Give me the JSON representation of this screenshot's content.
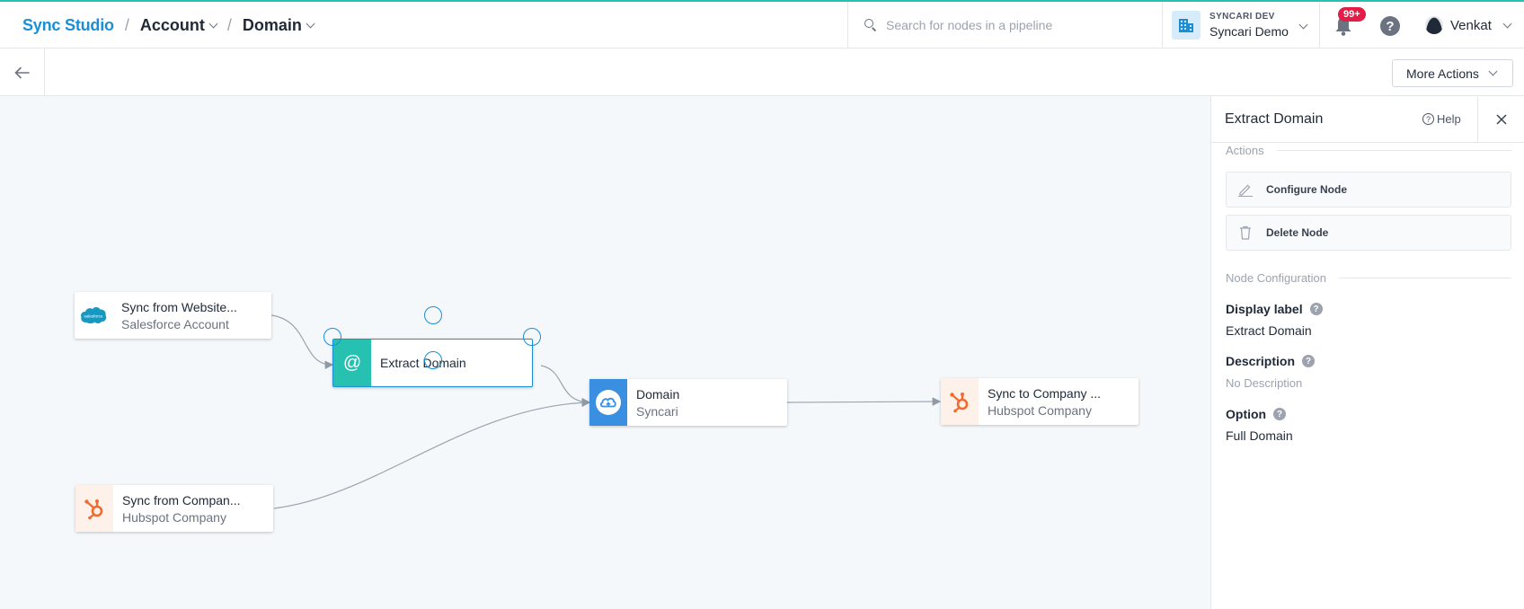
{
  "header": {
    "breadcrumbs": [
      "Sync Studio",
      "Account",
      "Domain"
    ],
    "search": {
      "placeholder": "Search for nodes in a pipeline"
    },
    "org": {
      "env": "SYNCARI DEV",
      "name": "Syncari Demo"
    },
    "notifications": {
      "badge": "99+"
    },
    "help_label": "?",
    "user": {
      "name": "Venkat"
    }
  },
  "toolbar": {
    "more_actions_label": "More Actions"
  },
  "canvas": {
    "nodes": [
      {
        "title": "Sync from Website...",
        "subtitle": "Salesforce Account",
        "icon": "salesforce-icon"
      },
      {
        "title": "Extract Domain",
        "subtitle": "",
        "icon": "at-sign-icon",
        "selected": true
      },
      {
        "title": "Domain",
        "subtitle": "Syncari",
        "icon": "cloud-sync-icon"
      },
      {
        "title": "Sync to Company ...",
        "subtitle": "Hubspot Company",
        "icon": "hubspot-icon"
      },
      {
        "title": "Sync from Compan...",
        "subtitle": "Hubspot Company",
        "icon": "hubspot-icon"
      }
    ],
    "salesforce_logo_text": "salesforce",
    "at_symbol": "@"
  },
  "panel": {
    "title": "Extract Domain",
    "help_label": "Help",
    "actions_title": "Actions",
    "configure_label": "Configure Node",
    "delete_label": "Delete Node",
    "config_title": "Node Configuration",
    "fields": [
      {
        "label": "Display label",
        "value": "Extract Domain"
      },
      {
        "label": "Description",
        "value": "No Description"
      },
      {
        "label": "Option",
        "value": "Full Domain"
      }
    ]
  },
  "colors": {
    "accent": "#1a8fd6",
    "teal": "#26c1b0",
    "hubspot": "#f26a2e",
    "syncari_blue": "#3b8fe0",
    "badge": "#e11d48"
  }
}
